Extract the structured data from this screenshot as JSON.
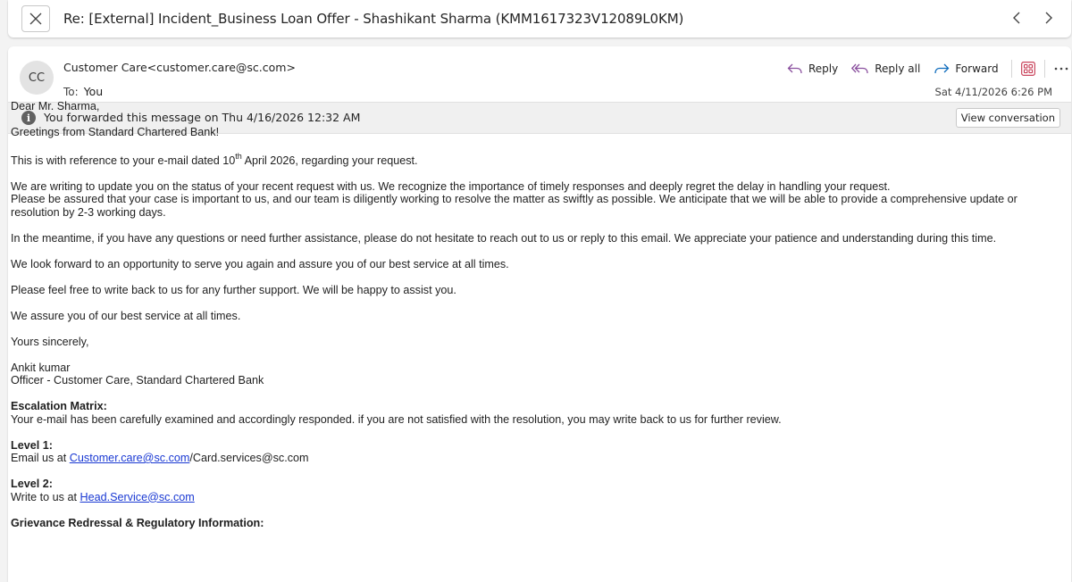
{
  "subject": "Re: [External] Incident_Business Loan Offer - Shashikant Sharma  (KMM1617323V12089L0KM)",
  "avatar_initials": "CC",
  "sender": "Customer Care<customer.care@sc.com>",
  "to_label": "To:",
  "to_value": "You",
  "actions": {
    "reply": "Reply",
    "reply_all": "Reply all",
    "forward": "Forward"
  },
  "date": "Sat 4/11/2026 6:26 PM",
  "info_bar": {
    "text": "You forwarded this message on Thu 4/16/2026 12:32 AM",
    "button": "View conversation"
  },
  "body": {
    "greeting": "Dear Mr. Sharma,",
    "greetings_line": "Greetings from Standard Chartered Bank!",
    "ref_pre": "This is with reference to your e-mail dated 10",
    "ref_sup": "th",
    "ref_post": " April 2026, regarding your request.",
    "update_1": "We are writing to update you on the status of your recent request with us. We recognize the importance of timely responses and deeply regret the delay in handling your request.",
    "update_2": "Please be assured that your case is important to us, and our team is diligently working to resolve the matter as swiftly as possible. We anticipate that we will be able to provide a comprehensive update or resolution by 2-3 working days.",
    "meantime": "In the meantime, if you have any questions or need further assistance, please do not hesitate to reach out to us or reply to this email. We appreciate your patience and understanding during this time.",
    "look_forward": "We look forward to an opportunity to serve you again and assure you of our best service at all times.",
    "feel_free": "Please feel free to write back to us for any further support. We will be happy to assist you.",
    "assure": "We assure you of our best service at all times.",
    "closing": "Yours sincerely,",
    "signer_name": "Ankit kumar",
    "signer_title": "Officer - Customer Care, Standard Chartered Bank",
    "escalation_heading": "Escalation Matrix:",
    "escalation_text": "Your e-mail has been carefully examined and accordingly responded. if you are not satisfied with the resolution, you may write back to us for further review.",
    "level1_heading": "Level 1:",
    "level1_pre": "Email us at ",
    "level1_link": "Customer.care@sc.com",
    "level1_post": "/Card.services@sc.com",
    "level2_heading": "Level 2:",
    "level2_pre": "Write to us at ",
    "level2_link": "Head.Service@sc.com",
    "grievance_heading": "Grievance Redressal & Regulatory Information:"
  },
  "colors": {
    "link": "#1a39d3",
    "accent": "#0f6cbd"
  }
}
